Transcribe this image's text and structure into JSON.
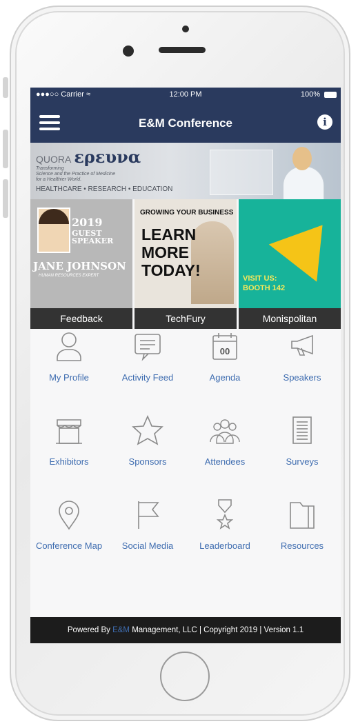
{
  "status": {
    "carrier": "●●●○○ Carrier ≈",
    "time": "12:00 PM",
    "battery": "100%"
  },
  "nav": {
    "title": "E&M Conference",
    "info_glyph": "i"
  },
  "banner": {
    "brand": "QUORA",
    "logo": "ερευνα",
    "tagline": [
      "Transforming",
      "Science and the Practice of Medicine",
      "for a Healthier World."
    ],
    "pillars": "HEALTHCARE • RESEARCH • EDUCATION"
  },
  "tiles": [
    {
      "caption": "Feedback",
      "year": "2019",
      "badge_line1": "GUEST",
      "badge_line2": "SPEAKER",
      "name": "JANE JOHNSON",
      "title": "HUMAN RESOURCES EXPERT"
    },
    {
      "caption": "TechFury",
      "top": "GROWING YOUR BUSINESS",
      "big": "LEARN MORE TODAY!"
    },
    {
      "caption": "Monispolitan",
      "visit": "VISIT US:",
      "booth": "BOOTH 142"
    }
  ],
  "menu": [
    {
      "label": "My Profile",
      "icon": "person-icon"
    },
    {
      "label": "Activity Feed",
      "icon": "chat-icon"
    },
    {
      "label": "Agenda",
      "icon": "calendar-icon",
      "icon_text": "00"
    },
    {
      "label": "Speakers",
      "icon": "megaphone-icon"
    },
    {
      "label": "Exhibitors",
      "icon": "booth-icon"
    },
    {
      "label": "Sponsors",
      "icon": "star-icon"
    },
    {
      "label": "Attendees",
      "icon": "people-icon"
    },
    {
      "label": "Surveys",
      "icon": "document-icon"
    },
    {
      "label": "Conference Map",
      "icon": "map-pin-icon"
    },
    {
      "label": "Social Media",
      "icon": "flag-icon"
    },
    {
      "label": "Leaderboard",
      "icon": "medal-icon"
    },
    {
      "label": "Resources",
      "icon": "folder-icon"
    }
  ],
  "footer": {
    "prefix": "Powered By ",
    "logo": "E&M",
    "rest": " Management, LLC | Copyright 2019 | Version 1.1"
  },
  "colors": {
    "navbar": "#2a3a5e",
    "menu_label": "#3f6db0",
    "footer": "#1c1c1c",
    "tile_caption": "#333333"
  }
}
